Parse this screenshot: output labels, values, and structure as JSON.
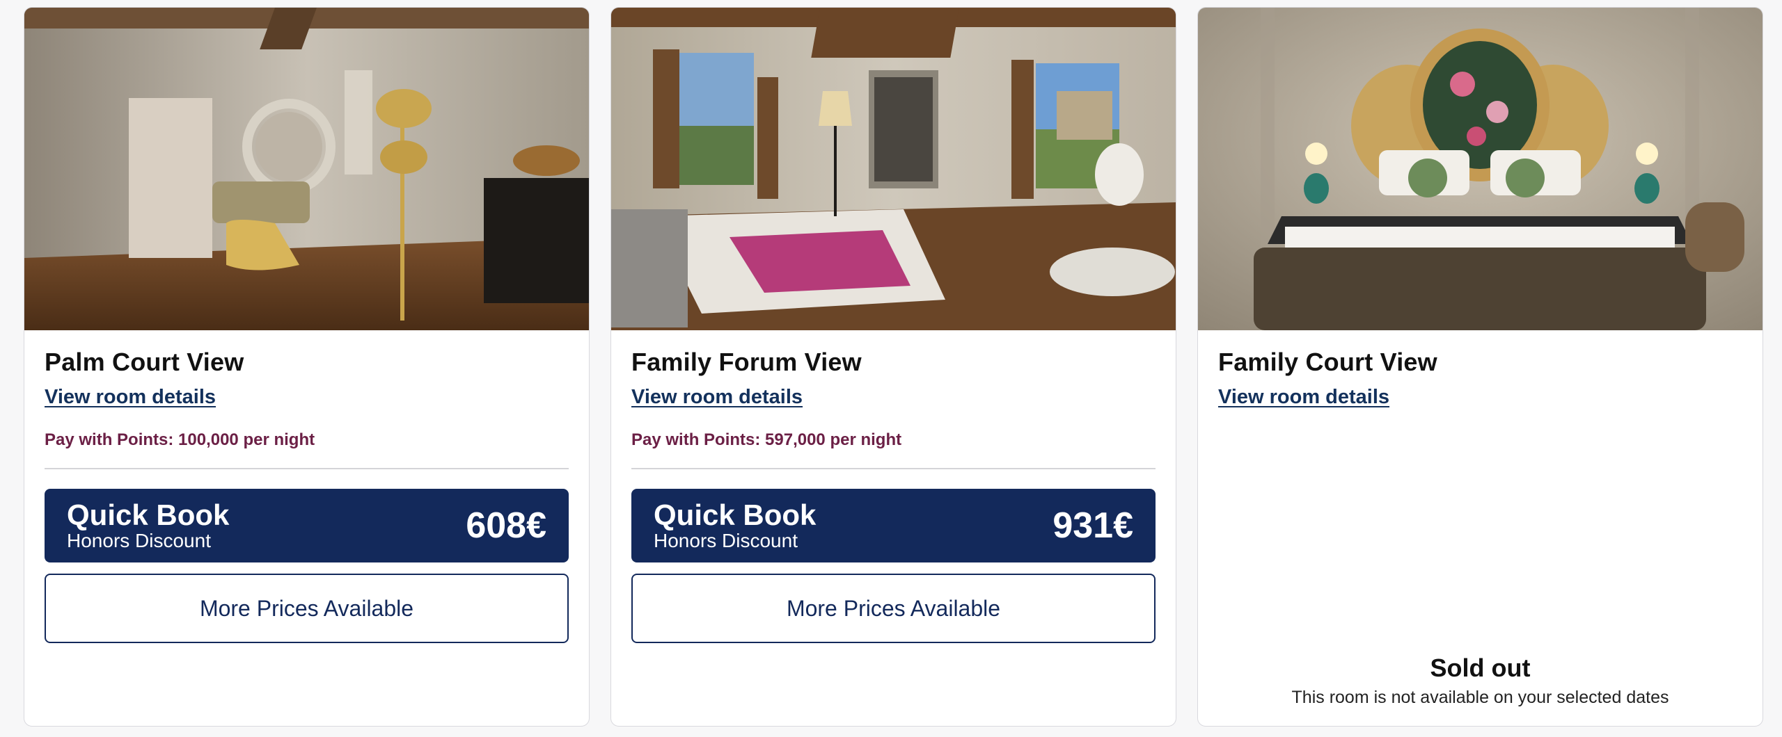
{
  "rooms": [
    {
      "name": "Palm Court View",
      "details_link": "View room details",
      "points": "Pay with Points: 100,000 per night",
      "quick_book": {
        "title": "Quick Book",
        "subtitle": "Honors Discount",
        "price": "608€"
      },
      "more_prices": "More Prices Available"
    },
    {
      "name": "Family Forum View",
      "details_link": "View room details",
      "points": "Pay with Points: 597,000 per night",
      "quick_book": {
        "title": "Quick Book",
        "subtitle": "Honors Discount",
        "price": "931€"
      },
      "more_prices": "More Prices Available"
    },
    {
      "name": "Family Court View",
      "details_link": "View room details",
      "sold_out": {
        "title": "Sold out",
        "message": "This room is not available on your selected dates"
      }
    }
  ],
  "colors": {
    "primary": "#13295b",
    "points": "#6b1f45",
    "link": "#13315c"
  }
}
